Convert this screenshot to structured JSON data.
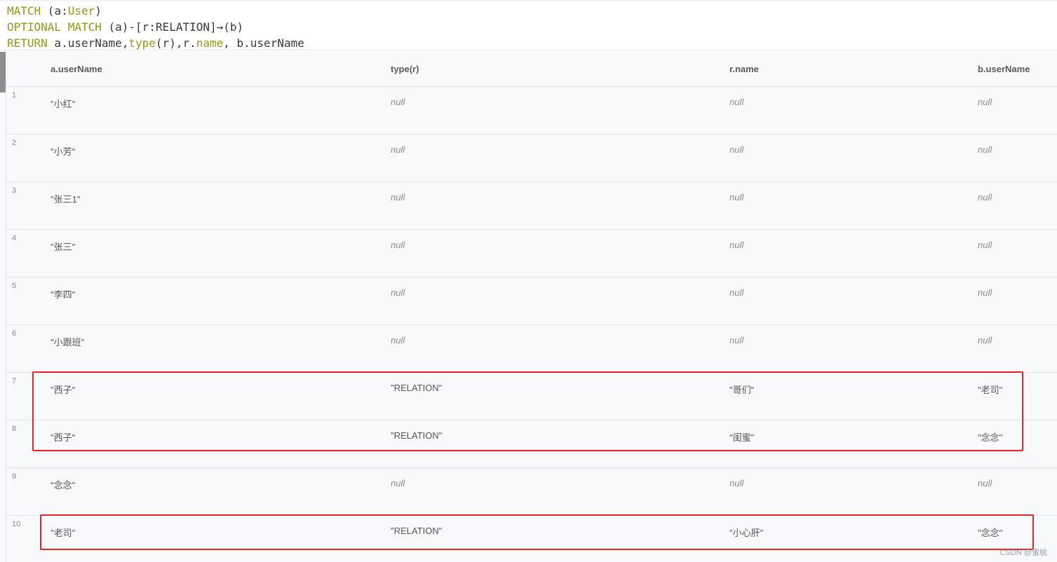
{
  "query": {
    "line1": {
      "kw": "MATCH",
      "rest_a": " (a:",
      "label": "User",
      "rest_b": ")"
    },
    "line2": {
      "kw": "OPTIONAL MATCH",
      "rest": " (a)-[r:RELATION]→(b)"
    },
    "line3": {
      "kw": "RETURN",
      "part1": " a.userName,",
      "fn": "type",
      "part2": "(r),r.",
      "prop": "name",
      "part3": ", b.userName"
    }
  },
  "table": {
    "columns": [
      "a.userName",
      "type(r)",
      "r.name",
      "b.userName"
    ],
    "rows": [
      {
        "num": "1",
        "cells": [
          "\"小红\"",
          "null",
          "null",
          "null"
        ]
      },
      {
        "num": "2",
        "cells": [
          "\"小芳\"",
          "null",
          "null",
          "null"
        ]
      },
      {
        "num": "3",
        "cells": [
          "\"张三1\"",
          "null",
          "null",
          "null"
        ]
      },
      {
        "num": "4",
        "cells": [
          "\"张三\"",
          "null",
          "null",
          "null"
        ]
      },
      {
        "num": "5",
        "cells": [
          "\"李四\"",
          "null",
          "null",
          "null"
        ]
      },
      {
        "num": "6",
        "cells": [
          "\"小跟班\"",
          "null",
          "null",
          "null"
        ]
      },
      {
        "num": "7",
        "cells": [
          "\"西子\"",
          "\"RELATION\"",
          "\"哥们\"",
          "\"老司\""
        ]
      },
      {
        "num": "8",
        "cells": [
          "\"西子\"",
          "\"RELATION\"",
          "\"闺蜜\"",
          "\"念念\""
        ]
      },
      {
        "num": "9",
        "cells": [
          "\"念念\"",
          "null",
          "null",
          "null"
        ]
      },
      {
        "num": "10",
        "cells": [
          "\"老司\"",
          "\"RELATION\"",
          "\"小心肝\"",
          "\"念念\""
        ]
      }
    ]
  },
  "colors": {
    "highlight": "#e5252a",
    "keyword": "#8f9a17"
  },
  "watermark": "CSDN @蜜桃"
}
